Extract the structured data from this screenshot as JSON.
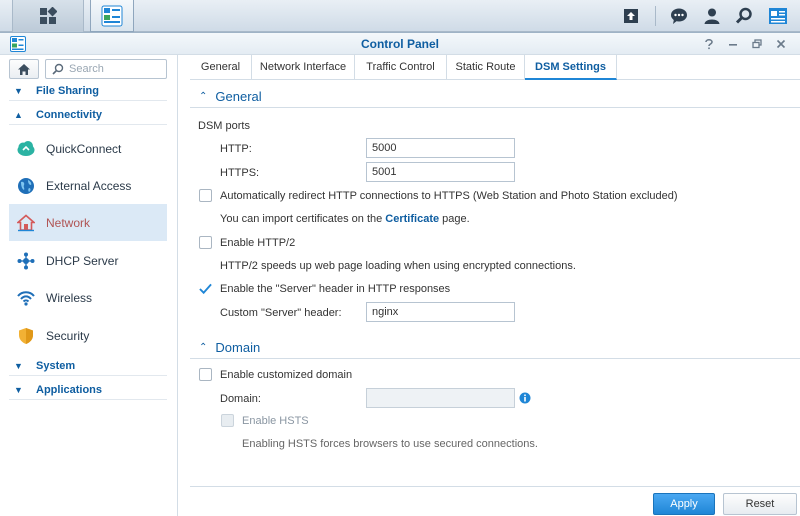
{
  "taskbar": {
    "main_menu_icon": "apps-grid-icon",
    "control_panel_icon": "control-panel-icon",
    "right_icons": [
      "upload-icon",
      "chat-icon",
      "user-icon",
      "search-icon",
      "widgets-icon"
    ]
  },
  "window": {
    "title": "Control Panel",
    "controls": [
      "help-icon",
      "minimize-icon",
      "restore-icon",
      "close-icon"
    ]
  },
  "sidebar": {
    "search_placeholder": "Search",
    "categories": {
      "file_sharing": "File Sharing",
      "connectivity": "Connectivity",
      "system": "System",
      "applications": "Applications"
    },
    "items": [
      {
        "label": "QuickConnect",
        "icon": "quickconnect-icon"
      },
      {
        "label": "External Access",
        "icon": "globe-icon"
      },
      {
        "label": "Network",
        "icon": "network-house-icon",
        "active": true
      },
      {
        "label": "DHCP Server",
        "icon": "dhcp-icon"
      },
      {
        "label": "Wireless",
        "icon": "wifi-icon"
      },
      {
        "label": "Security",
        "icon": "shield-icon"
      }
    ]
  },
  "tabs": [
    "General",
    "Network Interface",
    "Traffic Control",
    "Static Route",
    "DSM Settings"
  ],
  "active_tab": "DSM Settings",
  "general": {
    "title": "General",
    "dsm_ports_label": "DSM ports",
    "http_label": "HTTP:",
    "http_value": "5000",
    "https_label": "HTTPS:",
    "https_value": "5001",
    "redirect_label": "Automatically redirect HTTP connections to HTTPS (Web Station and Photo Station excluded)",
    "redirect_checked": false,
    "cert_prefix": "You can import certificates on the ",
    "cert_link": "Certificate",
    "cert_suffix": " page.",
    "http2_label": "Enable HTTP/2",
    "http2_checked": false,
    "http2_desc": "HTTP/2 speeds up web page loading when using encrypted connections.",
    "server_header_label": "Enable the \"Server\" header in HTTP responses",
    "server_header_checked": true,
    "custom_header_label": "Custom \"Server\" header:",
    "custom_header_value": "nginx"
  },
  "domain": {
    "title": "Domain",
    "enable_label": "Enable customized domain",
    "enable_checked": false,
    "domain_label": "Domain:",
    "domain_value": "",
    "hsts_label": "Enable HSTS",
    "hsts_desc": "Enabling HSTS forces browsers to use secured connections."
  },
  "buttons": {
    "apply": "Apply",
    "reset": "Reset"
  },
  "colors": {
    "accent": "#0f5ea1",
    "primary_button": "#1f86d6",
    "active_sidebar_bg": "#dbe9f6"
  }
}
